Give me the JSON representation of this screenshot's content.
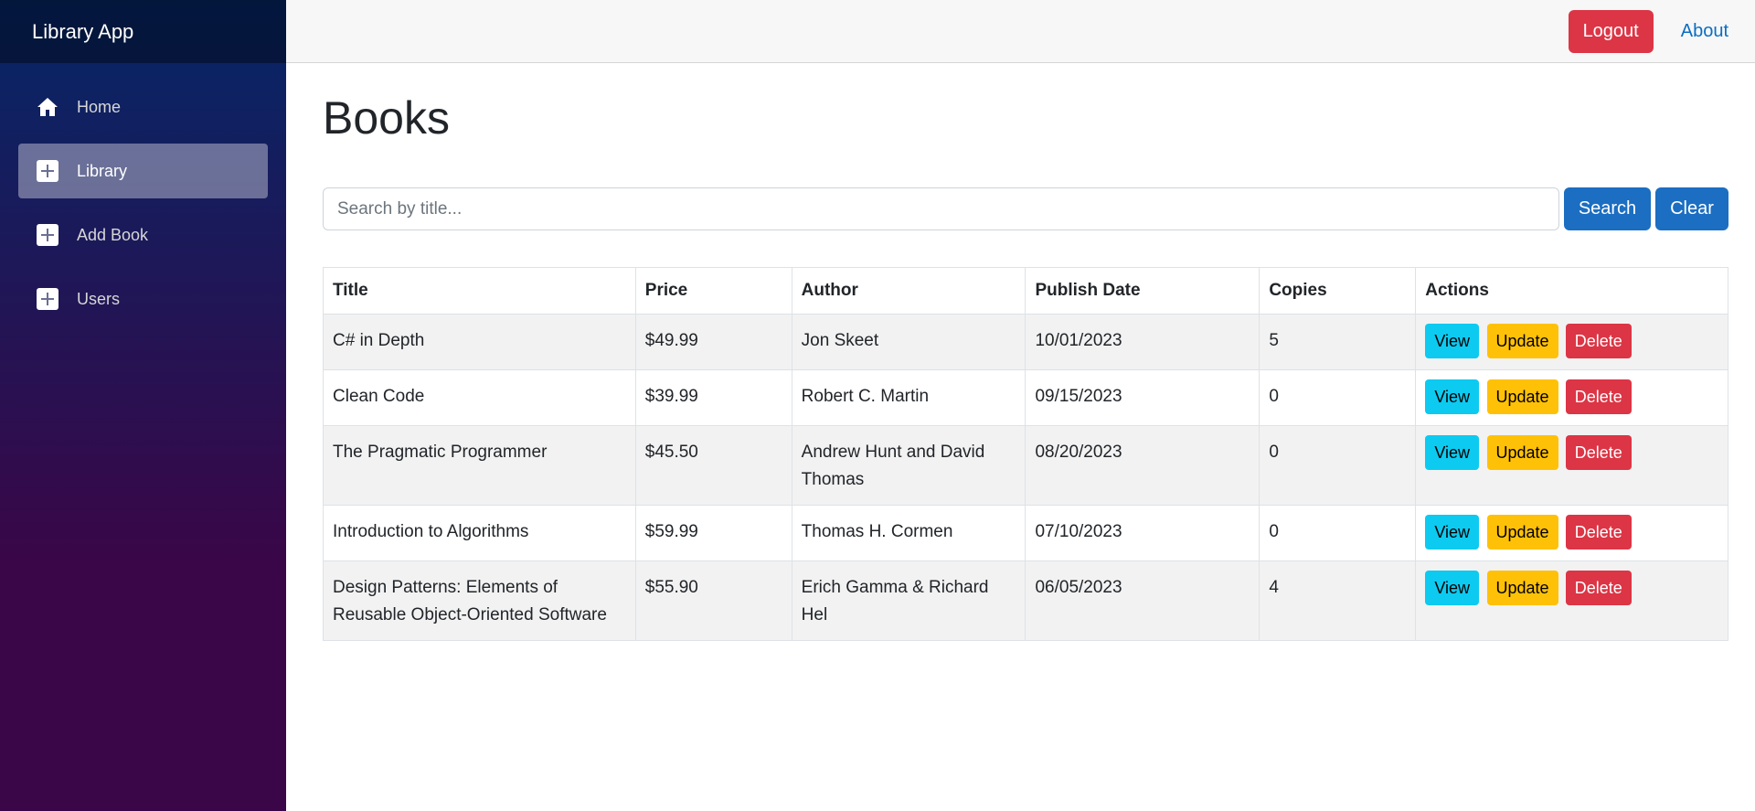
{
  "app": {
    "brand": "Library App"
  },
  "sidebar": {
    "items": [
      {
        "label": "Home",
        "icon": "home-icon",
        "active": false
      },
      {
        "label": "Library",
        "icon": "plus-icon",
        "active": true
      },
      {
        "label": "Add Book",
        "icon": "plus-icon",
        "active": false
      },
      {
        "label": "Users",
        "icon": "plus-icon",
        "active": false
      }
    ]
  },
  "topbar": {
    "logout_label": "Logout",
    "about_label": "About"
  },
  "page": {
    "title": "Books"
  },
  "search": {
    "placeholder": "Search by title...",
    "value": "",
    "search_label": "Search",
    "clear_label": "Clear"
  },
  "table": {
    "headers": [
      "Title",
      "Price",
      "Author",
      "Publish Date",
      "Copies",
      "Actions"
    ],
    "rows": [
      {
        "title": "C# in Depth",
        "price": "$49.99",
        "author": "Jon Skeet",
        "date": "10/01/2023",
        "copies": "5"
      },
      {
        "title": "Clean Code",
        "price": "$39.99",
        "author": "Robert C. Martin",
        "date": "09/15/2023",
        "copies": "0"
      },
      {
        "title": "The Pragmatic Programmer",
        "price": "$45.50",
        "author": "Andrew Hunt and David Thomas",
        "date": "08/20/2023",
        "copies": "0"
      },
      {
        "title": "Introduction to Algorithms",
        "price": "$59.99",
        "author": "Thomas H. Cormen",
        "date": "07/10/2023",
        "copies": "0"
      },
      {
        "title": "Design Patterns: Elements of Reusable Object-Oriented Software",
        "price": "$55.90",
        "author": "Erich Gamma & Richard Hel",
        "date": "06/05/2023",
        "copies": "4"
      }
    ],
    "action_labels": {
      "view": "View",
      "update": "Update",
      "delete": "Delete"
    }
  },
  "colors": {
    "danger": "#dc3545",
    "primary": "#1b6ec2",
    "info": "#0dcaf0",
    "warning": "#ffc107",
    "link": "#0a6ec2"
  }
}
